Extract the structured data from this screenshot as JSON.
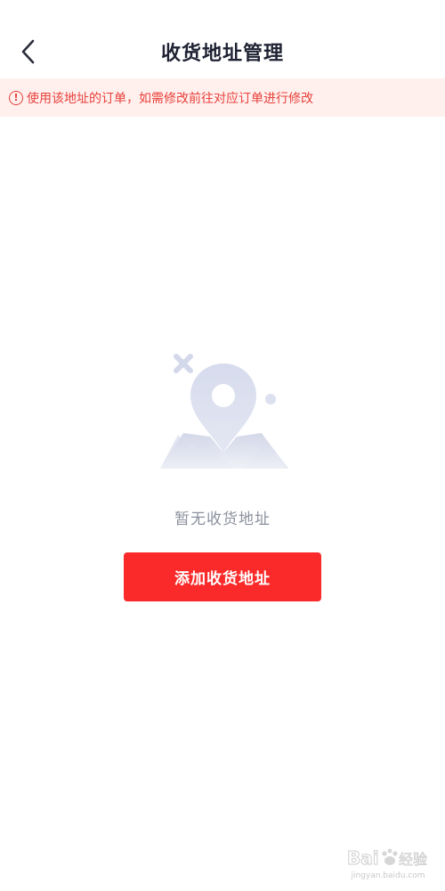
{
  "header": {
    "title": "收货地址管理",
    "back_icon": "chevron-left-icon"
  },
  "notice": {
    "icon": "info-icon",
    "icon_glyph": "!",
    "text": "使用该地址的订单，如需修改前往对应订单进行修改",
    "color": "#e8403a",
    "background": "#fff0ee"
  },
  "empty_state": {
    "illustration": "location-pin-mountains-illustration",
    "text": "暂无收货地址"
  },
  "actions": {
    "add_address_label": "添加收货地址",
    "accent_color": "#fb2a2a"
  },
  "watermark": {
    "logo_text": "Bai经验",
    "url": "jingyan.baidu.com"
  }
}
